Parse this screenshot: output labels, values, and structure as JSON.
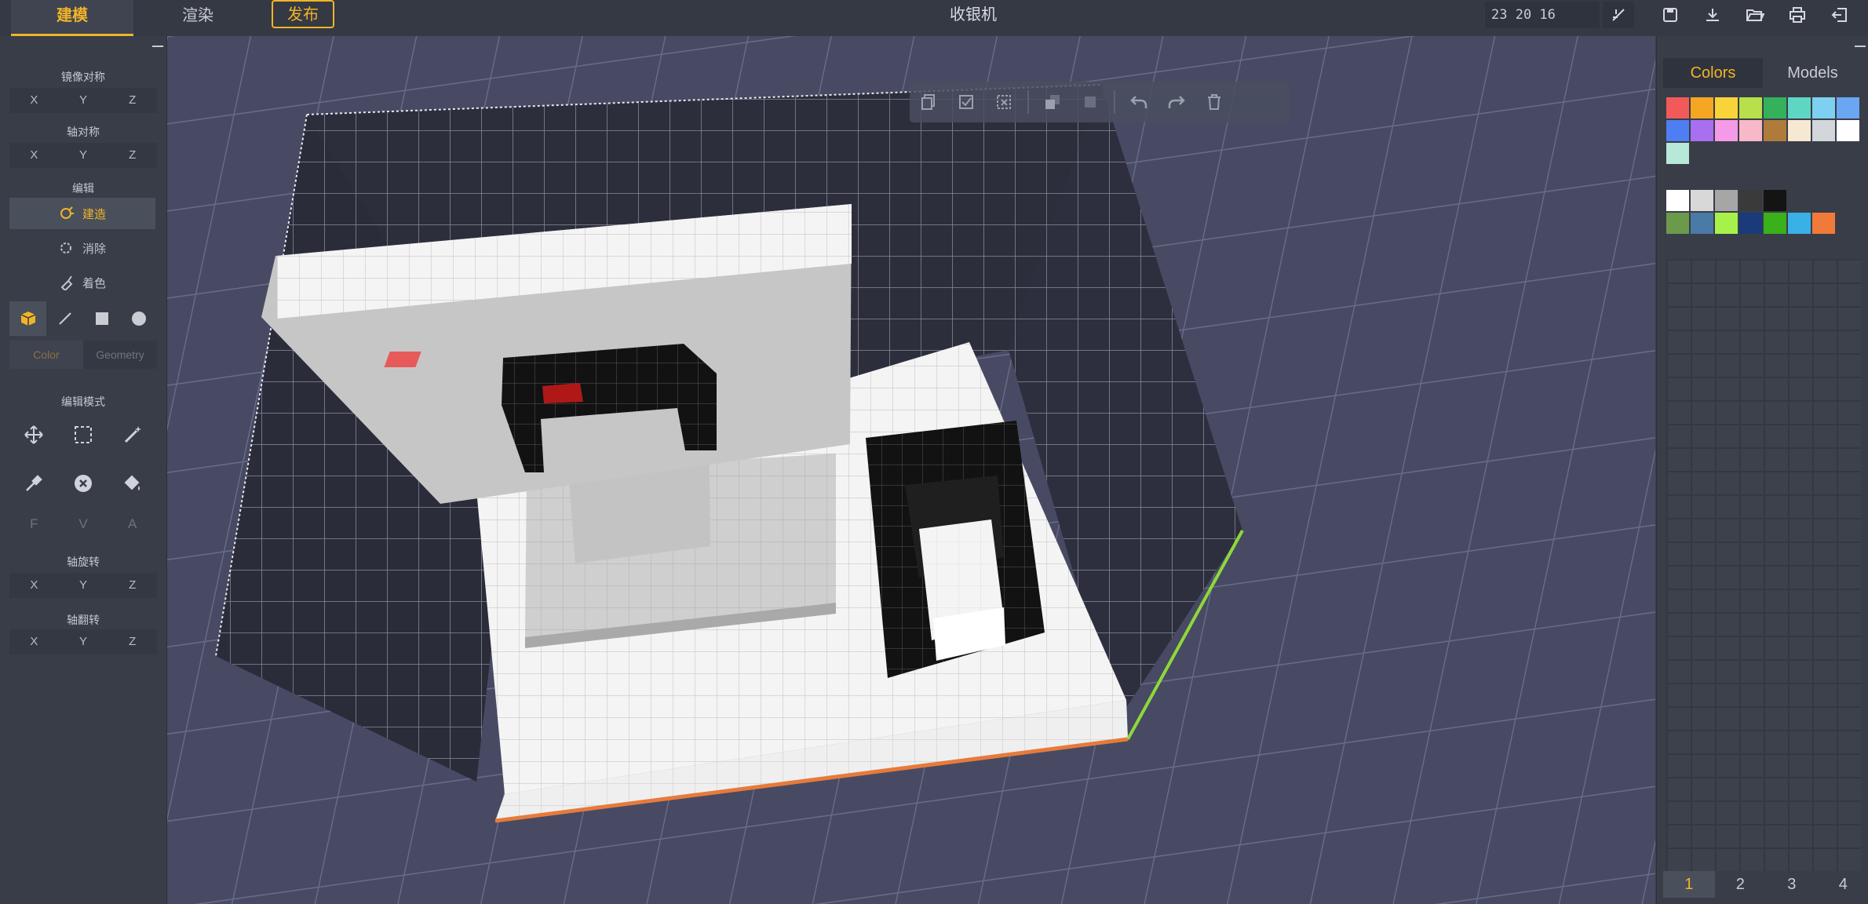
{
  "topbar": {
    "tabs": {
      "build": "建模",
      "render": "渲染",
      "publish": "发布"
    },
    "title": "收银机",
    "dims": "23 20 16",
    "icons": [
      "measure-icon",
      "save-icon",
      "download-icon",
      "open-folder-icon",
      "print-icon",
      "exit-icon"
    ]
  },
  "left": {
    "mirror_title": "镜像对称",
    "axis_title": "轴对称",
    "edit_title": "编辑",
    "axes": {
      "x": "X",
      "y": "Y",
      "z": "Z"
    },
    "tools": {
      "build": "建造",
      "erase": "消除",
      "paint": "着色"
    },
    "subtabs": {
      "color": "Color",
      "geometry": "Geometry"
    },
    "mode_title": "编辑模式",
    "fva": {
      "f": "F",
      "v": "V",
      "a": "A"
    },
    "rotate_title": "轴旋转",
    "flip_title": "轴翻转",
    "accent": "#f0b429"
  },
  "right": {
    "tabs": {
      "colors": "Colors",
      "models": "Models"
    },
    "palette_main": [
      "#f25a5a",
      "#f5a623",
      "#f8d43a",
      "#b8e04a",
      "#34b15a",
      "#5fd6c4",
      "#7ed0f0",
      "#6aa6f2",
      "#4f7ef2",
      "#a86ff0",
      "#f59ae6",
      "#f7b8c8",
      "#b07a3a",
      "#f7e8d4",
      "#d3d6da",
      "#ffffff",
      "#b8e8d8"
    ],
    "palette_recent": [
      "#ffffff",
      "#d8d8d8",
      "#a6a6a6",
      "#3a3a3a",
      "#141414",
      "#ffffff00",
      "#ffffff00",
      "#ffffff00",
      "#6a9a4a",
      "#4a7aa6",
      "#a6f24a",
      "#1a3a7a",
      "#3ab01a",
      "#3ab0e6",
      "#f07a3a"
    ],
    "pages": [
      "1",
      "2",
      "3",
      "4"
    ]
  }
}
